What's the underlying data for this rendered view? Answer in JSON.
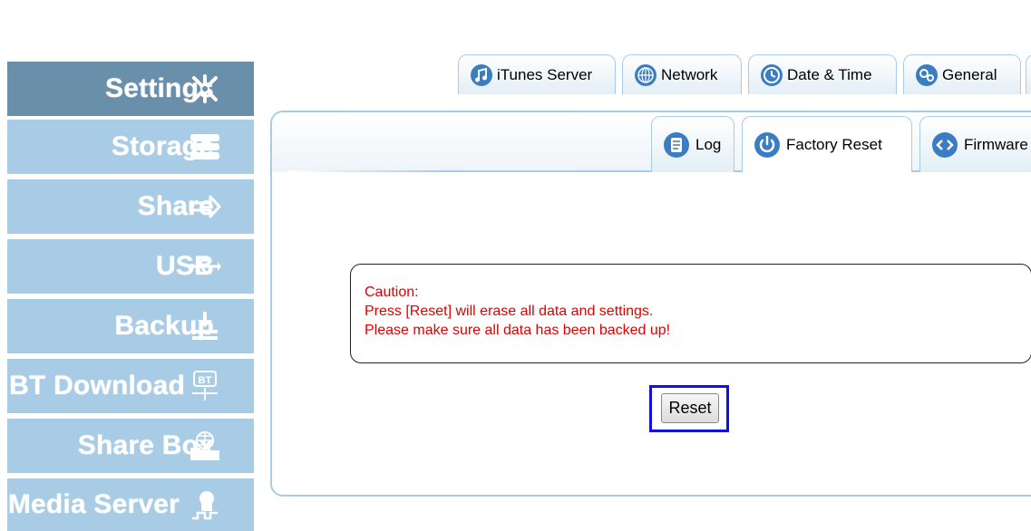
{
  "sidebar": {
    "items": [
      {
        "label": "Settings",
        "icon": "settings-icon",
        "active": true
      },
      {
        "label": "Storage",
        "icon": "storage-icon",
        "active": false
      },
      {
        "label": "Share",
        "icon": "share-icon",
        "active": false
      },
      {
        "label": "USB",
        "icon": "usb-icon",
        "active": false
      },
      {
        "label": "Backup",
        "icon": "backup-icon",
        "active": false
      },
      {
        "label": "BT Download",
        "icon": "bt-download-icon",
        "active": false
      },
      {
        "label": "Share Box",
        "icon": "share-box-icon",
        "active": false
      },
      {
        "label": "Media Server",
        "icon": "media-server-icon",
        "active": false
      }
    ]
  },
  "tabs": [
    {
      "label": "iTunes Server",
      "icon": "music-note-icon"
    },
    {
      "label": "Network",
      "icon": "globe-icon"
    },
    {
      "label": "Date & Time",
      "icon": "clock-icon"
    },
    {
      "label": "General",
      "icon": "gears-icon"
    }
  ],
  "subtabs": [
    {
      "label": "Log",
      "icon": "log-icon",
      "active": false
    },
    {
      "label": "Factory Reset",
      "icon": "power-icon",
      "active": true
    },
    {
      "label": "Firmware",
      "icon": "firmware-icon",
      "active": false
    }
  ],
  "caution": {
    "lines": [
      "Caution:",
      "Press [Reset] will erase all data and settings.",
      "Please make sure all data has been backed up!"
    ]
  },
  "reset_button": {
    "label": "Reset"
  },
  "colors": {
    "sidebar_active": "#6a8fab",
    "sidebar_item": "#a9cce6",
    "caution_text": "#e00000",
    "highlight_frame": "#1010ee",
    "tab_icon": "#3b7dc2"
  }
}
